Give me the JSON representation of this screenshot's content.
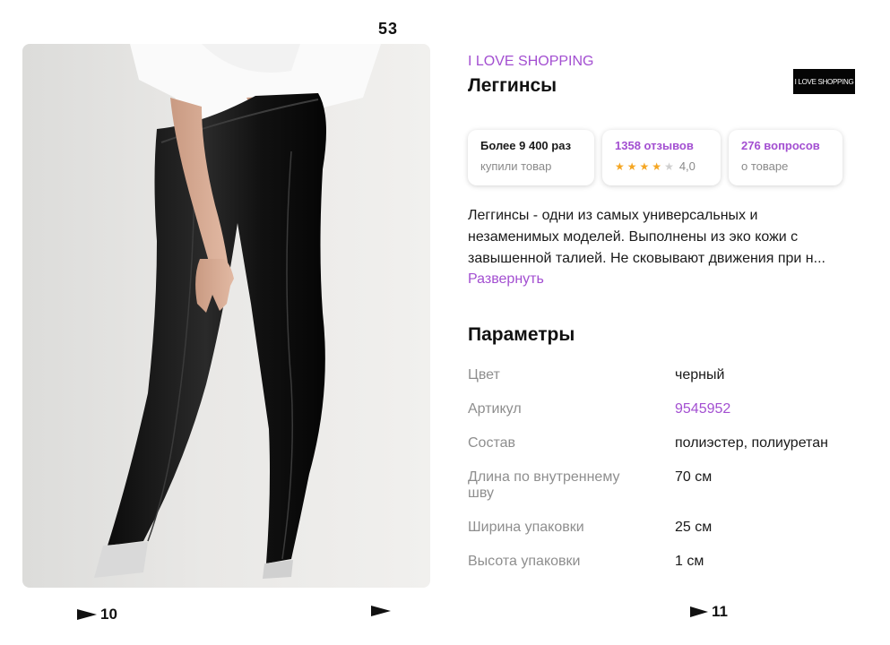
{
  "page_number_top": "53",
  "page_markers": {
    "left": "10",
    "middle": "",
    "right": "11"
  },
  "product": {
    "brand": "I LOVE SHOPPING",
    "title": "Леггинсы",
    "logo_text": "I LOVE SHOPPING"
  },
  "stats": {
    "bought": {
      "title": "Более 9 400 раз",
      "subtitle": "купили товар"
    },
    "reviews": {
      "title": "1358 отзывов",
      "rating": "4,0",
      "stars": 4,
      "stars_max": 5
    },
    "questions": {
      "title": "276 вопросов",
      "subtitle": "о товаре"
    }
  },
  "description": {
    "lines": [
      "Леггинсы - одни из самых универсальных и",
      "незаменимых моделей. Выполнены из эко кожи с",
      "завышенной талией. Не сковывают движения при н..."
    ],
    "expand_label": "Развернуть"
  },
  "params": {
    "title": "Параметры",
    "rows": [
      {
        "label": "Цвет",
        "value": "черный"
      },
      {
        "label": "Артикул",
        "value": "9545952"
      },
      {
        "label": "Состав",
        "value": "полиэстер, полиуретан"
      },
      {
        "label": "Длина по внутреннему шву",
        "value": "70 см"
      },
      {
        "label": "Ширина упаковки",
        "value": "25 см"
      },
      {
        "label": "Высота упаковки",
        "value": "1 см"
      }
    ]
  },
  "colors": {
    "accent": "#a34fd1",
    "star": "#f5a623",
    "muted": "#8e8e8e"
  }
}
